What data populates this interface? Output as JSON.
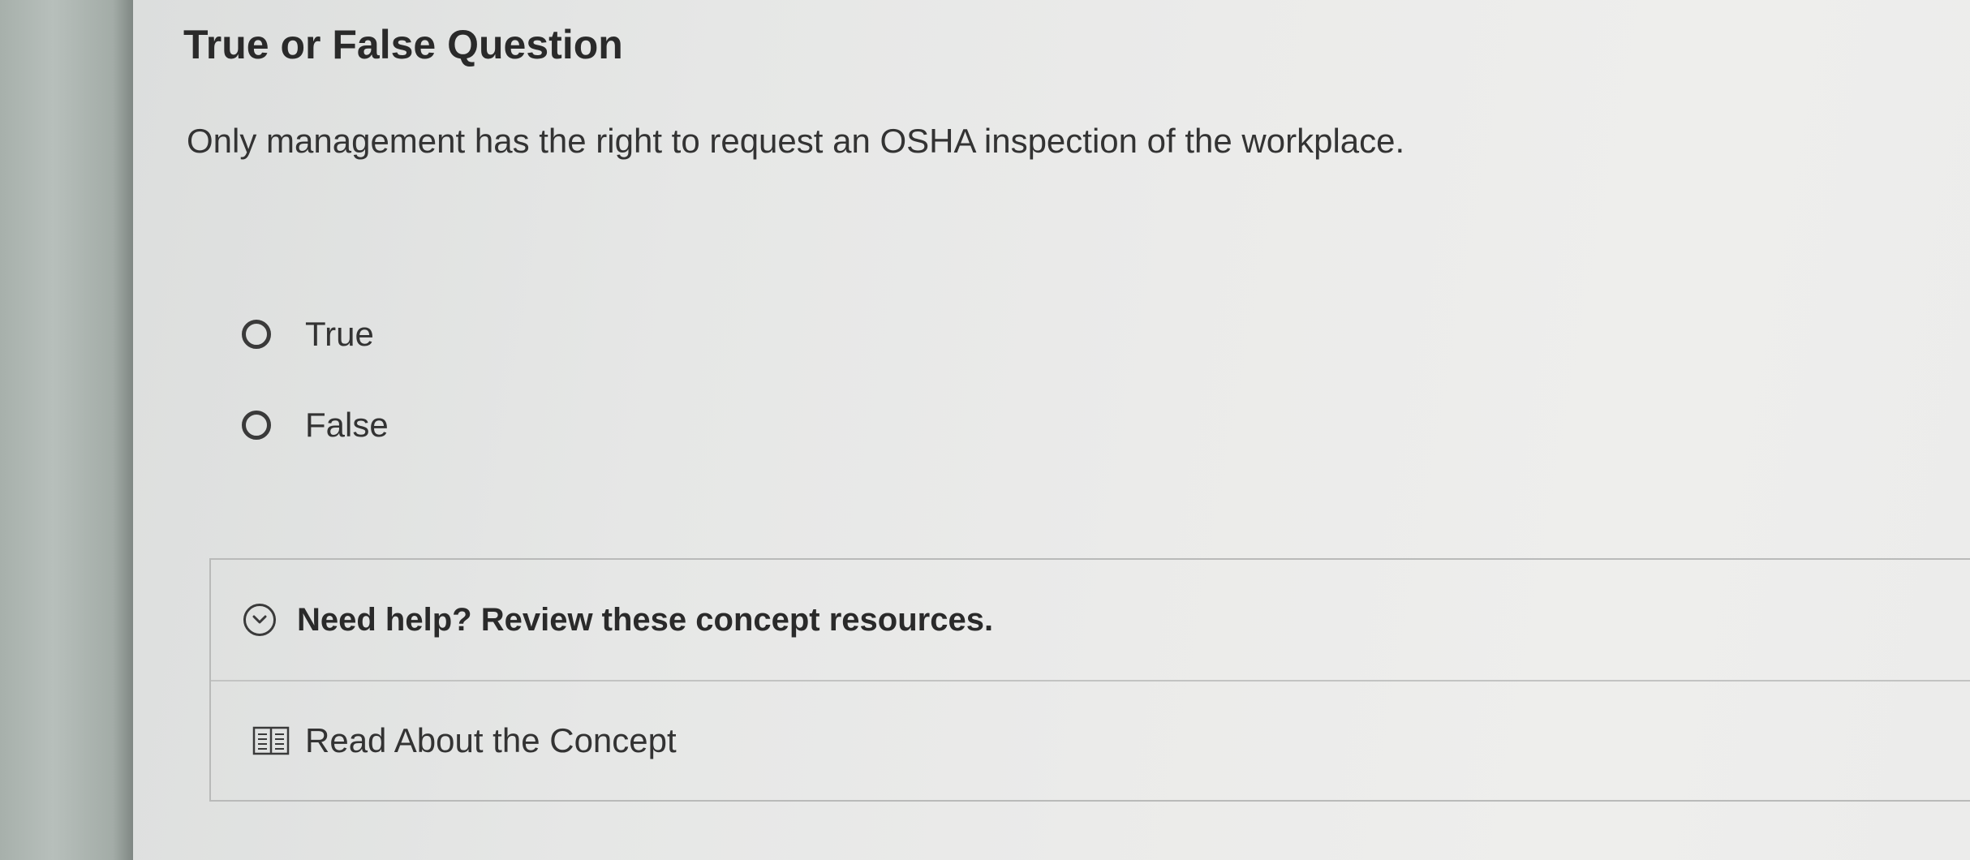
{
  "question": {
    "heading": "True or False Question",
    "prompt": "Only management has the right to request an OSHA inspection of the workplace."
  },
  "options": [
    {
      "label": "True",
      "selected": false
    },
    {
      "label": "False",
      "selected": false
    }
  ],
  "help": {
    "toggle_label": "Need help? Review these concept resources.",
    "resources": [
      {
        "label": "Read About the Concept",
        "icon": "book-icon"
      }
    ]
  }
}
